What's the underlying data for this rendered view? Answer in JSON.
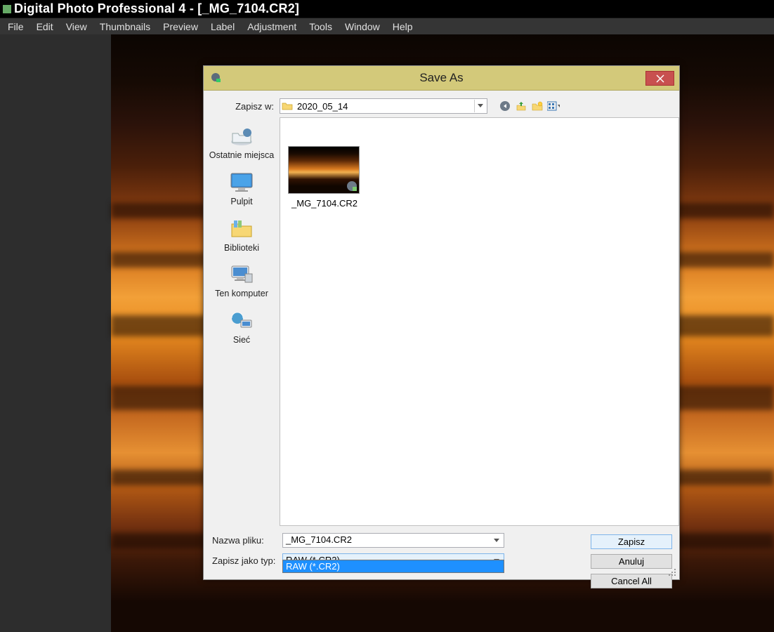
{
  "app": {
    "title_prefix": "Digital Photo Professional 4",
    "title_sep": " - ",
    "document": "[_MG_7104.CR2]"
  },
  "menu": {
    "items": [
      "File",
      "Edit",
      "View",
      "Thumbnails",
      "Preview",
      "Label",
      "Adjustment",
      "Tools",
      "Window",
      "Help"
    ]
  },
  "dialog": {
    "title": "Save As",
    "save_in_label": "Zapisz w:",
    "folder": "2020_05_14",
    "toolbar_icons": [
      "back-icon",
      "up-one-level-icon",
      "new-folder-icon",
      "view-menu-icon"
    ],
    "places": [
      {
        "key": "recent",
        "label": "Ostatnie miejsca"
      },
      {
        "key": "desktop",
        "label": "Pulpit"
      },
      {
        "key": "libraries",
        "label": "Biblioteki"
      },
      {
        "key": "computer",
        "label": "Ten komputer"
      },
      {
        "key": "network",
        "label": "Sieć"
      }
    ],
    "file_item": {
      "name": "_MG_7104.CR2"
    },
    "filename_label": "Nazwa pliku:",
    "filename_value": "_MG_7104.CR2",
    "filetype_label": "Zapisz jako typ:",
    "filetype_value": "RAW (*.CR2)",
    "filetype_options": [
      "RAW (*.CR2)"
    ],
    "buttons": {
      "save": "Zapisz",
      "cancel": "Anuluj",
      "cancel_all": "Cancel All"
    }
  }
}
